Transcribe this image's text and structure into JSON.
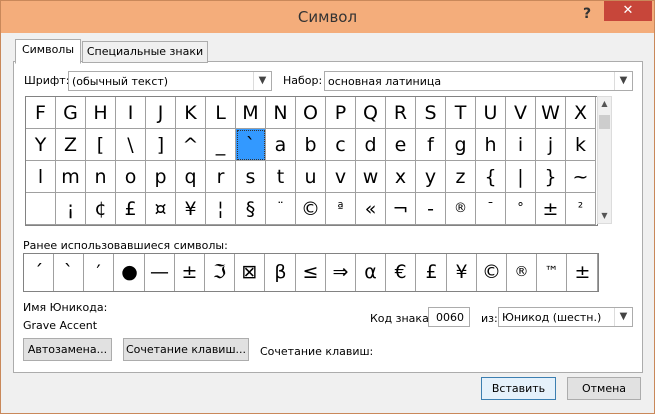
{
  "window": {
    "title": "Символ",
    "help": "?",
    "close": "✕"
  },
  "tabs": [
    {
      "label": "Символы",
      "active": true
    },
    {
      "label": "Специальные знаки",
      "active": false
    }
  ],
  "font": {
    "label": "Шрифт:",
    "value": "(обычный текст)"
  },
  "subset": {
    "label": "Набор:",
    "value": "основная латиница"
  },
  "symbols": [
    [
      "F",
      "G",
      "H",
      "I",
      "J",
      "K",
      "L",
      "M",
      "N",
      "O",
      "P",
      "Q",
      "R",
      "S",
      "T",
      "U",
      "V",
      "W",
      "X"
    ],
    [
      "Y",
      "Z",
      "[",
      "\\",
      "]",
      "^",
      "_",
      "`",
      "a",
      "b",
      "c",
      "d",
      "e",
      "f",
      "g",
      "h",
      "i",
      "j",
      "k"
    ],
    [
      "l",
      "m",
      "n",
      "o",
      "p",
      "q",
      "r",
      "s",
      "t",
      "u",
      "v",
      "w",
      "x",
      "y",
      "z",
      "{",
      "|",
      "}",
      "~"
    ],
    [
      "",
      "¡",
      "¢",
      "£",
      "¤",
      "¥",
      "¦",
      "§",
      "¨",
      "©",
      "ª",
      "«",
      "¬",
      "-",
      "®",
      "¯",
      "°",
      "±",
      "²"
    ]
  ],
  "selected_symbol": {
    "row": 1,
    "col": 7
  },
  "recent_label": "Ранее использовавшиеся символы:",
  "recent_symbols": [
    "´",
    "`",
    "′",
    "●",
    "—",
    "±",
    "ℑ",
    "⊠",
    "β",
    "≤",
    "⇒",
    "α",
    "€",
    "£",
    "¥",
    "©",
    "®",
    "™",
    "±"
  ],
  "unicode_name_label": "Имя Юникода:",
  "unicode_name_value": "Grave Accent",
  "char_code": {
    "label": "Код знака:",
    "value": "0060"
  },
  "from": {
    "label": "из:",
    "value": "Юникод (шестн.)"
  },
  "buttons": {
    "autocorrect": "Автозамена...",
    "shortcut_key": "Сочетание клавиш...",
    "shortcut_label": "Сочетание клавиш:",
    "insert": "Вставить",
    "cancel": "Отмена"
  },
  "colors": {
    "titlebar": "#f4ad7b",
    "close": "#c7463a",
    "selection": "#3399ff"
  }
}
